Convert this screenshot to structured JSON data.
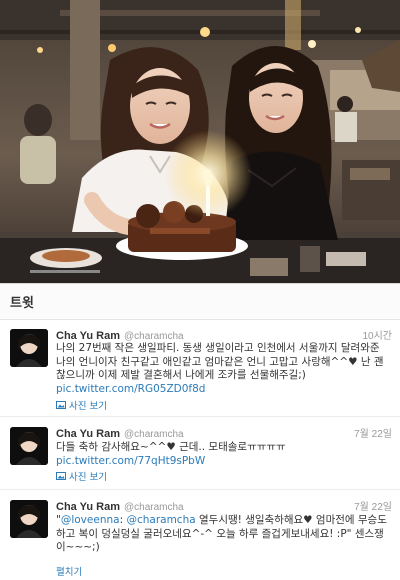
{
  "panel": {
    "title": "트윗"
  },
  "tweets": [
    {
      "name": "Cha Yu Ram",
      "handle": "@charamcha",
      "time": "10시간",
      "text_before": "나의 27번째 작은 생일파티. 동생 생일이라고 인천에서 서울까지 달려와준 나의 언니이자 친구같고 애인같고 엄마같은 언니 고맙고 사랑해^^♥ 난 괜찮으니까 이제 제발 결혼해서 나에게 조카를 선물해주길;)",
      "link": "pic.twitter.com/RG05ZD0f8d",
      "text_after": "",
      "action": "사진 보기"
    },
    {
      "name": "Cha Yu Ram",
      "handle": "@charamcha",
      "time": "7월 22일",
      "text_before": "다들 축하 감사해요~^^♥ 근데.. 모태솔로ㅠㅠㅠㅠ",
      "link": "pic.twitter.com/77qHt9sPbW",
      "text_after": "",
      "action": "사진 보기"
    },
    {
      "name": "Cha Yu Ram",
      "handle": "@charamcha",
      "time": "7월 22일",
      "text_before": "\"",
      "mention1": "@loveenna",
      "mid1": ": ",
      "mention2": "@charamcha",
      "text_after": " 열두시땡! 생일축하해요♥ 엄마전에 무승도하고 복이 덩실덩실 굴러오네요^-^ 오늘 하루 즐겁게보내세요! :P\" 센스쟁이~~~;)",
      "action": "펼치기"
    }
  ],
  "colors": {
    "link": "#2b7bb9",
    "muted": "#999999",
    "text": "#333333"
  },
  "icons": {
    "media": "photo-icon",
    "avatar": "profile-avatar"
  }
}
